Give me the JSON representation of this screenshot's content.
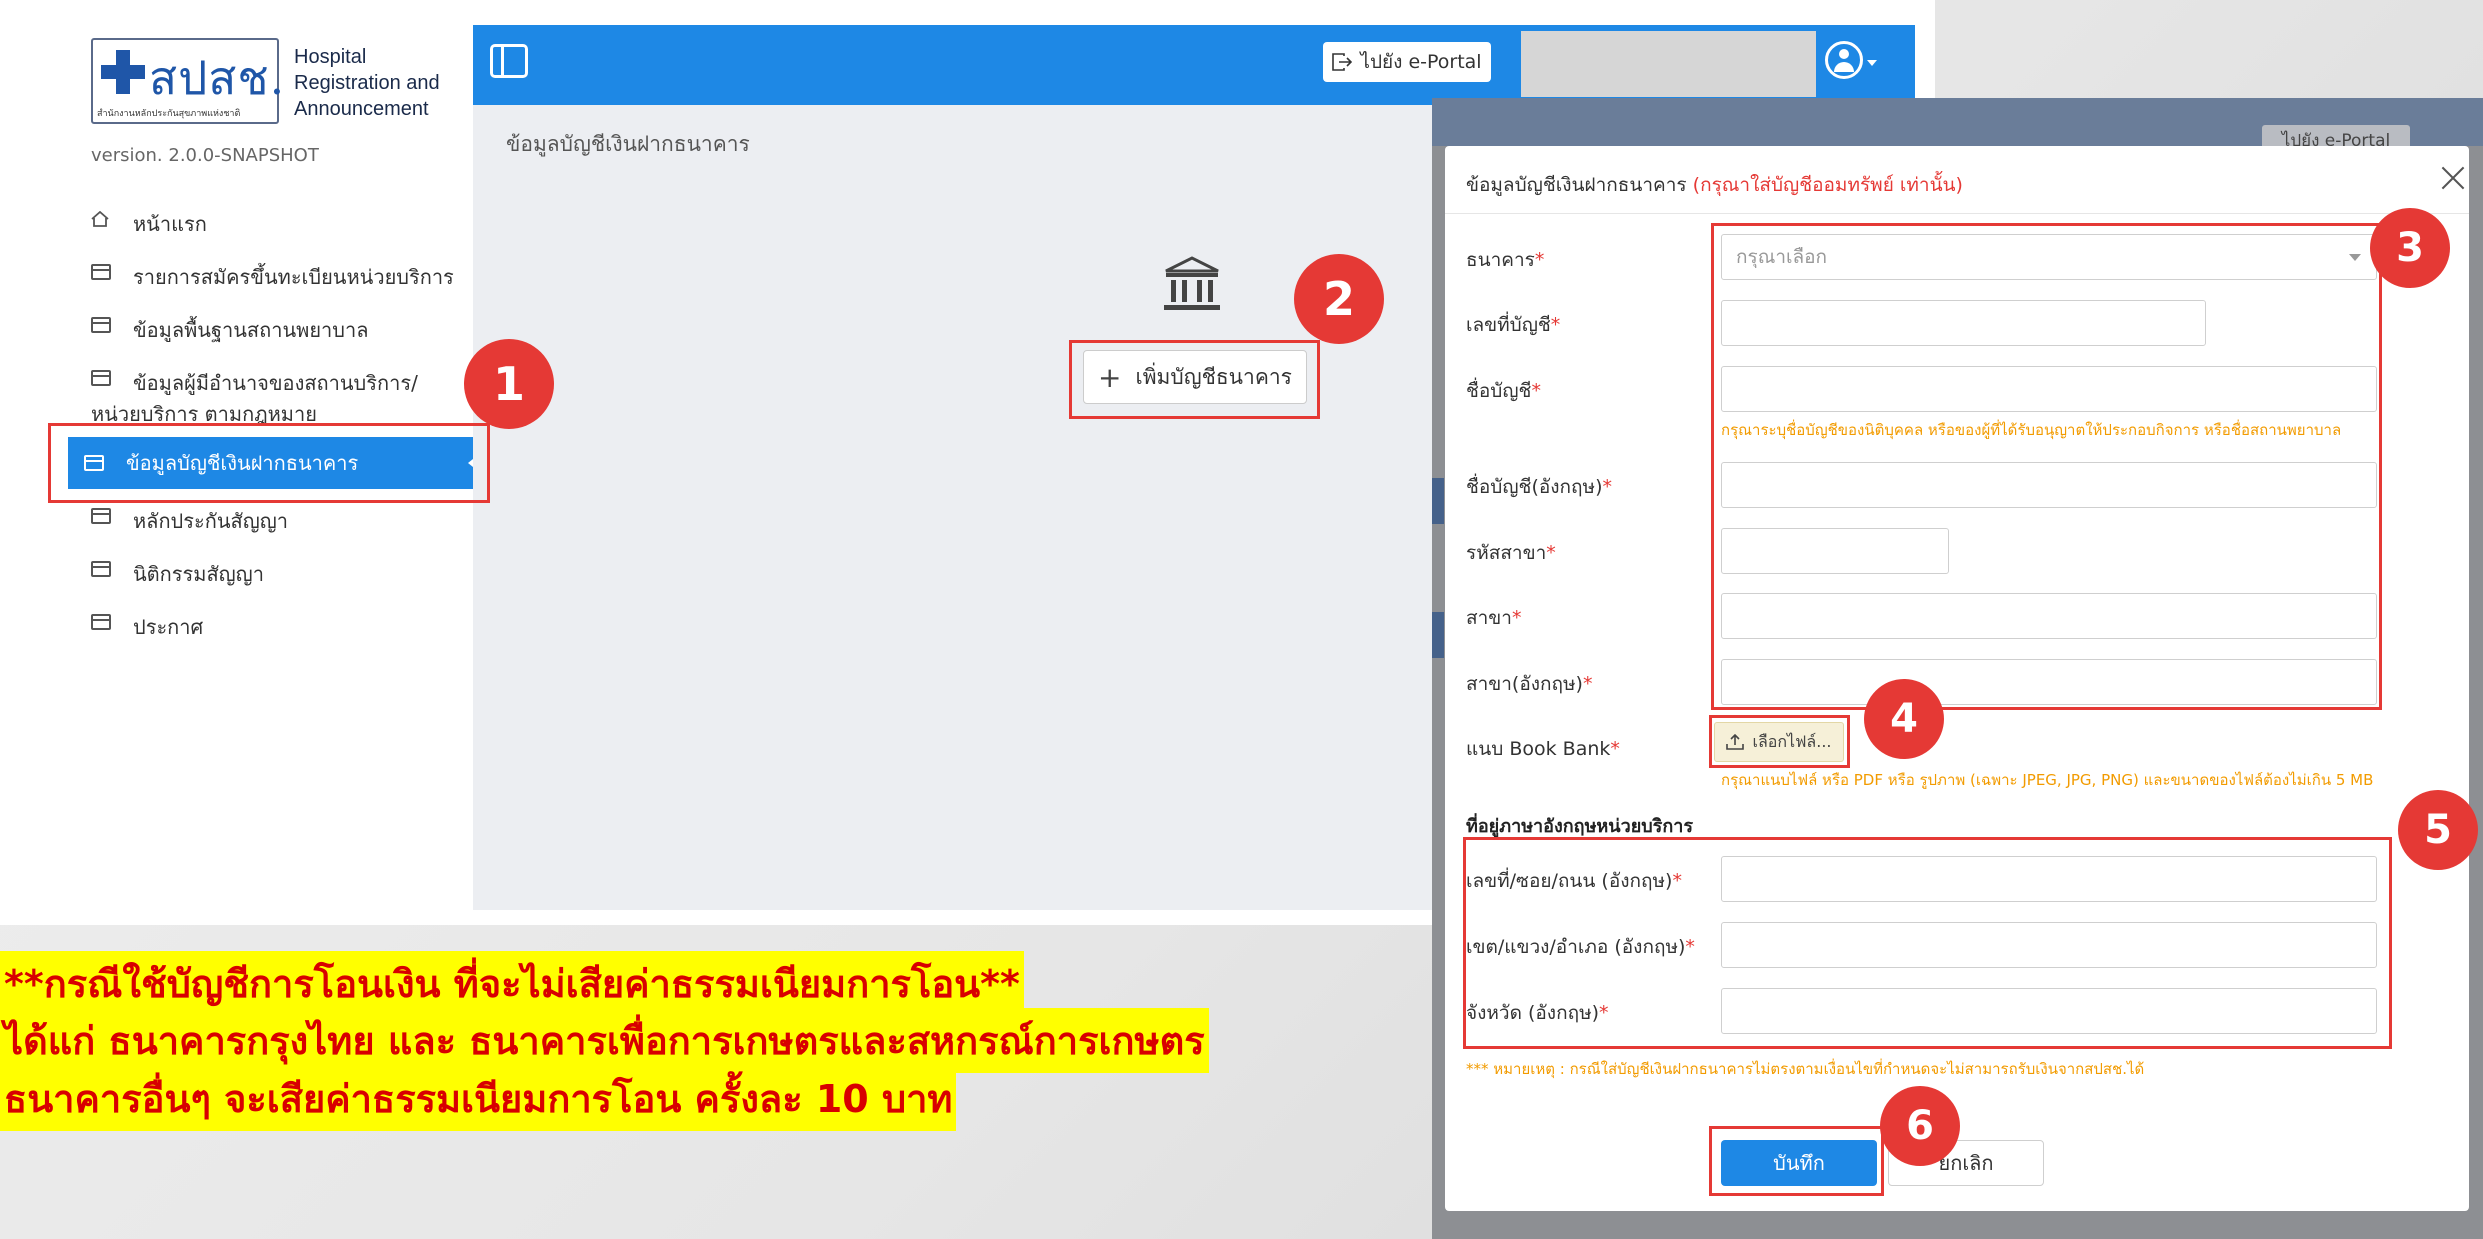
{
  "logo": {
    "thai": "สปสช.",
    "small": "สำนักงานหลักประกันสุขภาพแห่งชาติ",
    "title_lines": [
      "Hospital",
      "Registration and",
      "Announcement"
    ]
  },
  "version": "version. 2.0.0-SNAPSHOT",
  "sidebar": {
    "items": [
      {
        "label": "หน้าแรก",
        "icon": "home-icon"
      },
      {
        "label": "รายการสมัครขึ้นทะเบียนหน่วยบริการ",
        "icon": "calendar-icon"
      },
      {
        "label": "ข้อมูลพื้นฐานสถานพยาบาล",
        "icon": "calendar-icon"
      },
      {
        "label": "ข้อมูลผู้มีอำนาจของสถานบริการ/",
        "label2": "หน่วยบริการ ตามกฎหมาย",
        "icon": "calendar-icon"
      },
      {
        "label": "ข้อมูลบัญชีเงินฝากธนาคาร",
        "icon": "calendar-icon",
        "active": true
      },
      {
        "label": "หลักประกันสัญญา",
        "icon": "calendar-icon"
      },
      {
        "label": "นิติกรรมสัญญา",
        "icon": "calendar-icon"
      },
      {
        "label": "ประกาศ",
        "icon": "calendar-icon"
      }
    ]
  },
  "header": {
    "eportal_label": "ไปยัง e-Portal"
  },
  "content": {
    "title": "ข้อมูลบัญชีเงินฝากธนาคาร",
    "add_bank_label": "เพิ่มบัญชีธนาคาร"
  },
  "callouts": [
    "1",
    "2",
    "3",
    "4",
    "5",
    "6"
  ],
  "note_lines": [
    "**กรณีใช้บัญชีการโอนเงิน ที่จะไม่เสียค่าธรรมเนียมการโอน**",
    "ได้แก่ ธนาคารกรุงไทย และ ธนาคารเพื่อการเกษตรและสหกรณ์การเกษตร",
    "ธนาคารอื่นๆ จะเสียค่าธรรมเนียมการโอน ครั้งละ 10 บาท"
  ],
  "behind_label": "ไปยัง e-Portal",
  "modal": {
    "title": "ข้อมูลบัญชีเงินฝากธนาคาร",
    "title_note": "(กรุณาใส่บัญชีออมทรัพย์ เท่านั้น)",
    "fields": {
      "bank": {
        "label": "ธนาคาร",
        "placeholder": "กรุณาเลือก"
      },
      "account_no": {
        "label": "เลขที่บัญชี"
      },
      "account_name": {
        "label": "ชื่อบัญชี",
        "hint": "กรุณาระบุชื่อบัญชีของนิติบุคคล หรือของผู้ที่ได้รับอนุญาตให้ประกอบกิจการ หรือชื่อสถานพยาบาล"
      },
      "account_name_en": {
        "label": "ชื่อบัญชี(อังกฤษ)"
      },
      "branch_code": {
        "label": "รหัสสาขา"
      },
      "branch": {
        "label": "สาขา"
      },
      "branch_en": {
        "label": "สาขา(อังกฤษ)"
      },
      "bookbank": {
        "label": "แนบ Book Bank",
        "button": "เลือกไฟล์...",
        "hint": "กรุณาแนบไฟล์ หรือ PDF หรือ รูปภาพ (เฉพาะ JPEG, JPG, PNG) และขนาดของไฟล์ต้องไม่เกิน 5 MB"
      }
    },
    "section_title": "ที่อยู่ภาษาอังกฤษหน่วยบริการ",
    "address": {
      "street": {
        "label": "เลขที่/ซอย/ถนน (อังกฤษ)"
      },
      "district": {
        "label": "เขต/แขวง/อำเภอ (อังกฤษ)"
      },
      "province": {
        "label": "จังหวัด (อังกฤษ)"
      }
    },
    "footnote": "*** หมายเหตุ : กรณีใส่บัญชีเงินฝากธนาคารไม่ตรงตามเงื่อนไขที่กำหนดจะไม่สามารถรับเงินจากสปสช.ได้",
    "save_label": "บันทึก",
    "cancel_label": "ยกเลิก"
  },
  "colors": {
    "primary": "#1e88e5",
    "callout": "#e53935",
    "note_bg": "#ffff00",
    "note_text": "#d80000",
    "hint": "#f29b00"
  }
}
